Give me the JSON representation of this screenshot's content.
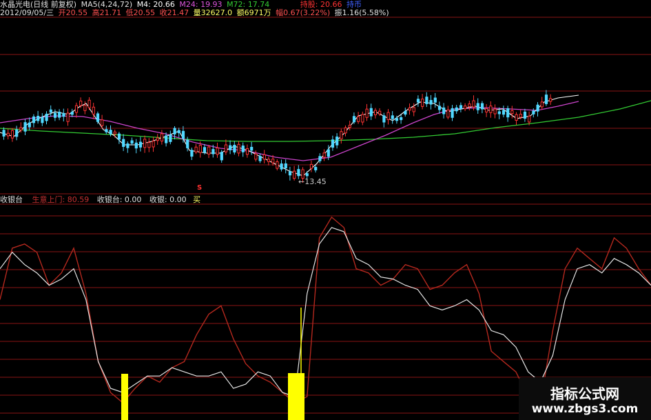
{
  "header": {
    "title": "水晶光电(日线 前复权)",
    "ma_label": "MA5(4,24,72)",
    "m4": "M4: 20.66",
    "m24": "M24: 19.93",
    "m72": "M72: 17.74",
    "hold": "持股: 20.66",
    "sell": "持币"
  },
  "info": {
    "date": "2012/09/05/三",
    "open": "开20.55",
    "high": "高21.71",
    "low": "低20.55",
    "close": "收21.47",
    "volume": "量32627.0",
    "amount": "额6971万",
    "change": "幅0.67(3.22%)",
    "amplitude": "振1.16(5.58%)"
  },
  "low_marker": "←13.45",
  "sell_marker": "S",
  "indicator": {
    "name": "收银台",
    "label1": "生意上门: 80.59",
    "label2": "收银台: 0.00",
    "label3": "收银: 0.00",
    "label4": "买"
  },
  "watermark": {
    "title": "指标公式网",
    "url": "www.zbgs3.com"
  },
  "colors": {
    "bg": "#000000",
    "up": "#ff3333",
    "down": "#50d8ff",
    "ma4": "#ffffff",
    "ma24": "#cc44cc",
    "ma72": "#33cc33",
    "grid": "#8a1414",
    "ind_red": "#b4281e",
    "ind_white": "#e6e6e6",
    "bar": "#ffff00"
  },
  "chart_data": {
    "type": "line",
    "title": "收银台",
    "series": [
      {
        "name": "生意上门",
        "values": [
          55,
          80,
          82,
          78,
          62,
          68,
          80,
          58,
          25,
          10,
          5,
          12,
          18,
          15,
          22,
          25,
          38,
          48,
          52,
          36,
          24,
          18,
          15,
          10,
          5,
          8,
          85,
          95,
          90,
          70,
          68,
          62,
          65,
          72,
          70,
          60,
          62,
          68,
          72,
          58,
          30,
          25,
          20,
          8,
          5,
          40,
          70,
          80,
          75,
          70,
          85,
          80,
          70,
          62
        ]
      },
      {
        "name": "收银台",
        "values": [
          70,
          78,
          72,
          68,
          62,
          65,
          70,
          55,
          25,
          12,
          10,
          14,
          18,
          18,
          22,
          20,
          18,
          18,
          20,
          12,
          14,
          20,
          18,
          10,
          8,
          58,
          82,
          90,
          88,
          75,
          72,
          66,
          65,
          62,
          60,
          52,
          50,
          52,
          55,
          50,
          40,
          38,
          32,
          20,
          15,
          28,
          55,
          70,
          72,
          68,
          75,
          72,
          68,
          62
        ]
      }
    ],
    "ylim": [
      0,
      100
    ]
  }
}
